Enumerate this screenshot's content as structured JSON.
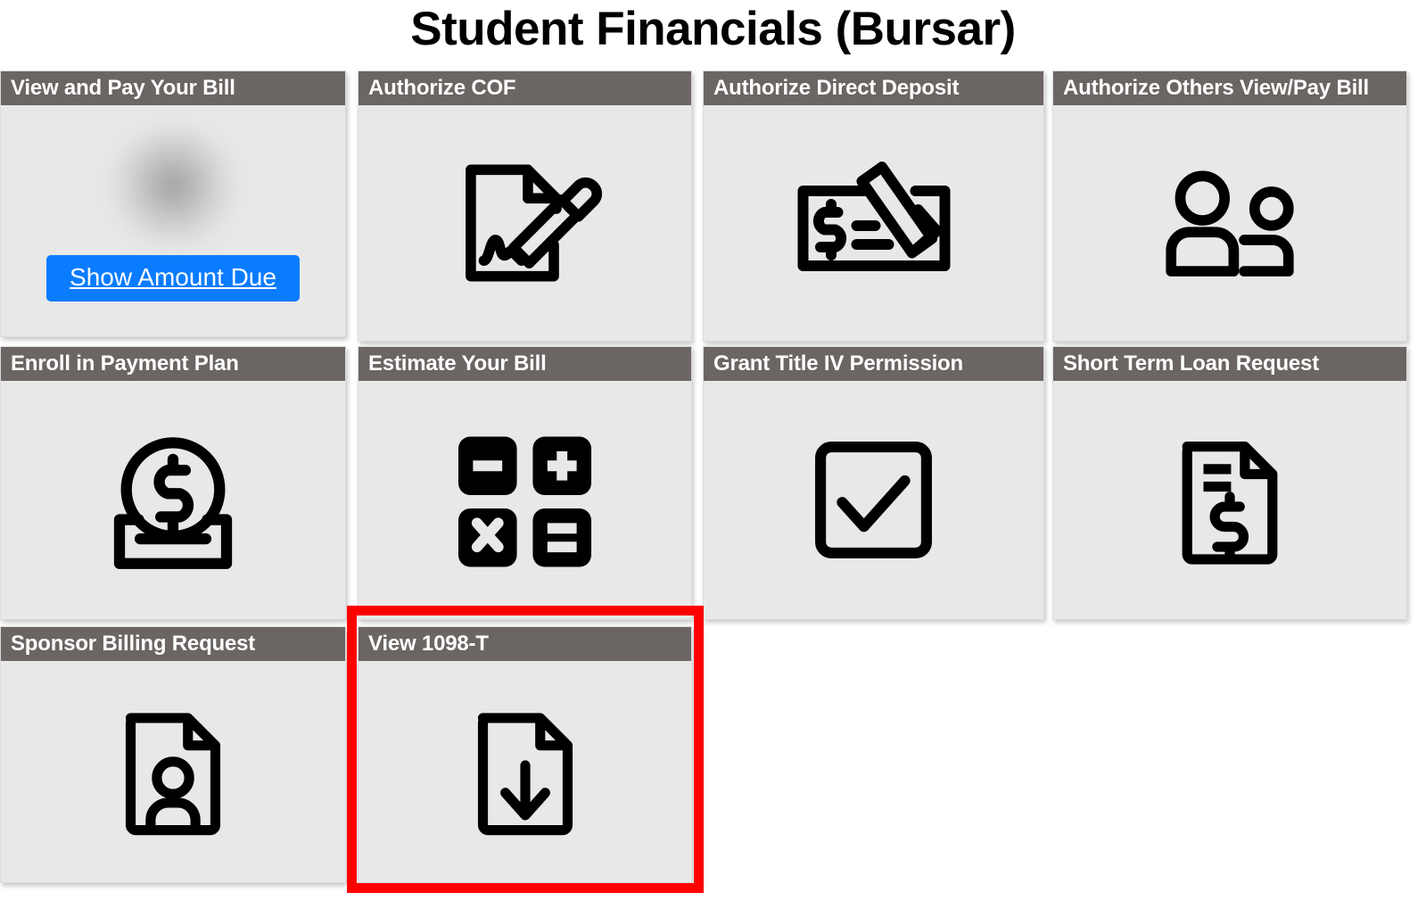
{
  "page": {
    "title": "Student Financials (Bursar)",
    "background_color": "#ffffff",
    "tile_header_color": "#6b6563",
    "tile_body_color": "#e8e8e8",
    "highlight_color": "#ff0000",
    "button_color": "#0a7cff"
  },
  "tiles": [
    {
      "id": "view-and-pay-your-bill",
      "label": "View and Pay Your Bill",
      "icon": "blurred-amount-icon",
      "button_label": "Show Amount Due",
      "highlighted": false
    },
    {
      "id": "authorize-cof",
      "label": "Authorize COF",
      "icon": "document-signature-pencil-icon",
      "highlighted": false
    },
    {
      "id": "authorize-direct-deposit",
      "label": "Authorize Direct Deposit",
      "icon": "check-with-pencil-icon",
      "highlighted": false
    },
    {
      "id": "authorize-others-view-pay-bill",
      "label": "Authorize Others View/Pay Bill",
      "icon": "two-people-icon",
      "highlighted": false
    },
    {
      "id": "enroll-in-payment-plan",
      "label": "Enroll in Payment Plan",
      "icon": "coin-into-tray-icon",
      "highlighted": false
    },
    {
      "id": "estimate-your-bill",
      "label": "Estimate Your Bill",
      "icon": "calculator-keys-icon",
      "highlighted": false
    },
    {
      "id": "grant-title-iv-permission",
      "label": "Grant Title IV Permission",
      "icon": "checkbox-checked-icon",
      "highlighted": false
    },
    {
      "id": "short-term-loan-request",
      "label": "Short Term Loan Request",
      "icon": "document-dollar-icon",
      "highlighted": false
    },
    {
      "id": "sponsor-billing-request",
      "label": "Sponsor Billing Request",
      "icon": "document-person-icon",
      "highlighted": false
    },
    {
      "id": "view-1098-t",
      "label": "View 1098-T",
      "icon": "document-download-arrow-icon",
      "highlighted": true
    }
  ]
}
